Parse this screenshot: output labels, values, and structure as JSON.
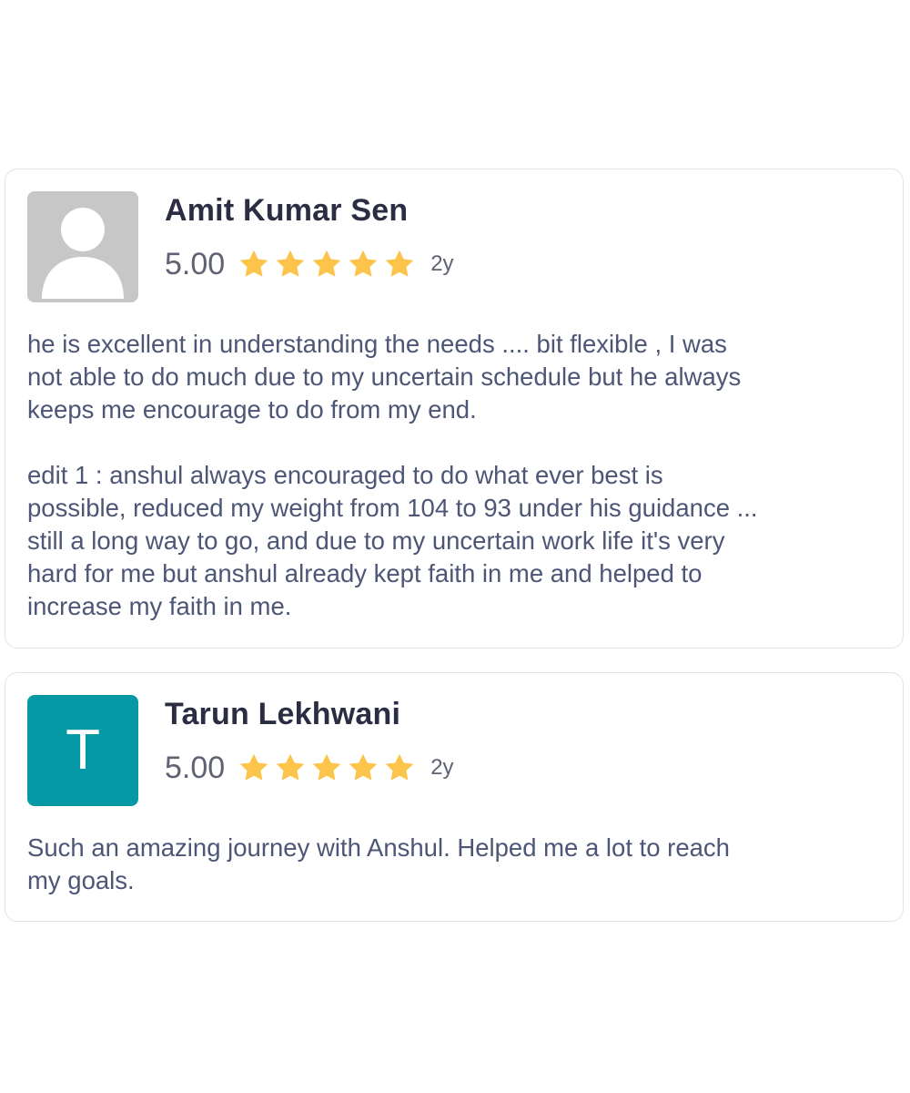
{
  "reviews": [
    {
      "name": "Amit Kumar Sen",
      "rating": "5.00",
      "stars": 5,
      "age": "2y",
      "avatar": {
        "type": "photo-placeholder-icon",
        "color": "#c7c7c7"
      },
      "text": "he is excellent in understanding the needs .... bit flexible , I was\nnot able to do much due to my uncertain schedule but he always\nkeeps me encourage to do from my end.\n\nedit 1 : anshul always encouraged to do what ever best is\npossible, reduced my weight from 104 to 93 under his guidance ...\nstill a long way to go, and due to my uncertain work life it's very\nhard for me but anshul already kept faith in me and helped to\nincrease my faith in me."
    },
    {
      "name": "Tarun Lekhwani",
      "rating": "5.00",
      "stars": 5,
      "age": "2y",
      "avatar": {
        "type": "initial",
        "initial": "T",
        "color": "#0599a5"
      },
      "text": "Such an amazing journey with Anshul. Helped me a lot to reach\nmy goals."
    }
  ],
  "colors": {
    "star": "#fcc44a",
    "name": "#2b2d42",
    "text": "#4d5676",
    "border": "#e3e3e3"
  }
}
